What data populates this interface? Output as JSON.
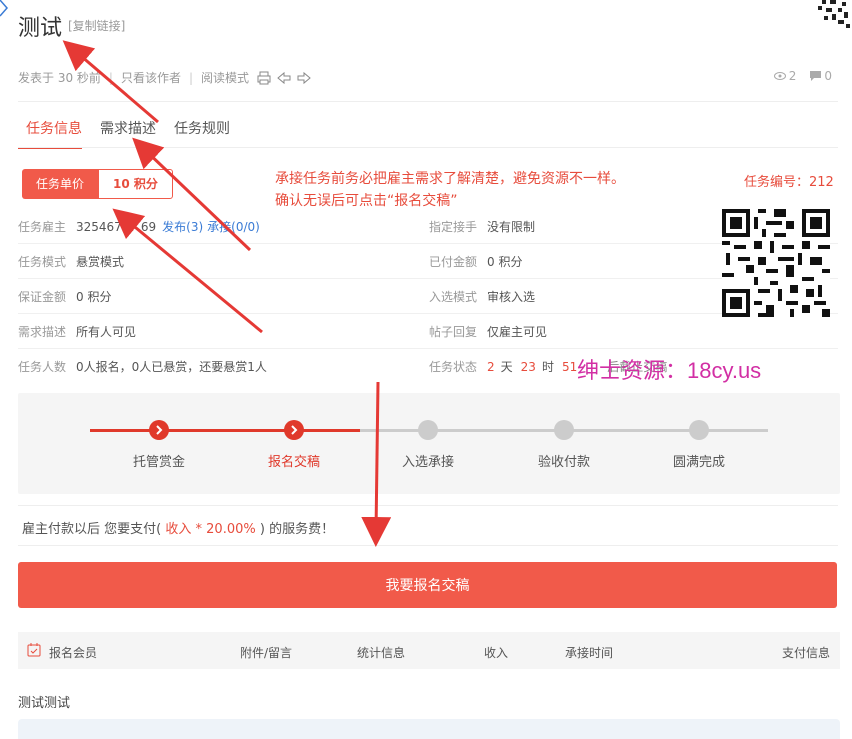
{
  "header": {
    "title": "测试",
    "copy_link": "[复制链接]",
    "posted": "发表于 30 秒前",
    "only_author": "只看该作者",
    "read_mode": "阅读模式",
    "views": "2",
    "replies": "0"
  },
  "tabs": [
    {
      "label": "任务信息",
      "active": true
    },
    {
      "label": "需求描述",
      "active": false
    },
    {
      "label": "任务规则",
      "active": false
    }
  ],
  "price": {
    "label": "任务单价",
    "value": "10 积分"
  },
  "notice": {
    "line1": "承接任务前务必把雇主需求了解清楚，避免资源不一样。",
    "line2": "确认无误后可点击“报名交稿”"
  },
  "task_no": "任务编号：212",
  "info": {
    "employer_label": "任务雇主",
    "employer_id": "32546777 69",
    "publish_label": "发布(3)",
    "accept_label": "承接(0/0)",
    "mode_label": "任务模式",
    "mode_value": "悬赏模式",
    "deposit_label": "保证金额",
    "deposit_value": "0 积分",
    "desc_label": "需求描述",
    "desc_value": "所有人可见",
    "people_label": "任务人数",
    "people_value": "0人报名，0人已悬赏，还要悬赏1人",
    "assign_label": "指定接手",
    "assign_value": "没有限制",
    "paid_label": "已付金额",
    "paid_value": "0 积分",
    "select_label": "入选模式",
    "select_value": "审核入选",
    "reply_label": "帖子回复",
    "reply_value": "仅雇主可见",
    "status_label": "任务状态",
    "status_days": "2",
    "status_days_unit": "天",
    "status_hours": "23",
    "status_hours_unit": "时",
    "status_minutes": "51",
    "status_tail": "后截止交稿"
  },
  "watermark": "绅士资源：18cy.us",
  "steps": [
    {
      "label": "托管赏金",
      "done": true
    },
    {
      "label": "报名交稿",
      "done": true
    },
    {
      "label": "入选承接",
      "done": false
    },
    {
      "label": "验收付款",
      "done": false
    },
    {
      "label": "圆满完成",
      "done": false
    }
  ],
  "fee": {
    "prefix": "雇主付款以后 您要支付(",
    "income": "收入",
    "mult": "*",
    "rate": "20.00%",
    "suffix": ") 的服务费！"
  },
  "submit_label": "我要报名交稿",
  "table": {
    "members": "报名会员",
    "attach": "附件/留言",
    "stats": "统计信息",
    "income": "收入",
    "accept_time": "承接时间",
    "pay_info": "支付信息"
  },
  "content_text": "测试测试",
  "colors": {
    "accent": "#e74c3c",
    "button": "#f15a4a",
    "watermark": "#d22fa4"
  }
}
